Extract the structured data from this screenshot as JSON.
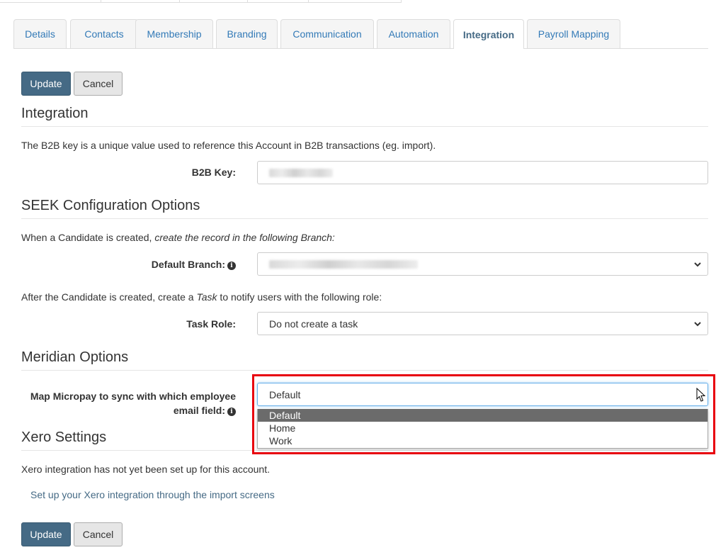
{
  "tabs": [
    {
      "label": "Details",
      "active": false
    },
    {
      "label": "Contacts",
      "active": false
    },
    {
      "label": "Membership",
      "active": false
    },
    {
      "label": "Branding",
      "active": false
    },
    {
      "label": "Communication",
      "active": false
    },
    {
      "label": "Automation",
      "active": false
    },
    {
      "label": "Integration",
      "active": true
    },
    {
      "label": "Payroll Mapping",
      "active": false
    }
  ],
  "actions": {
    "update_label": "Update",
    "cancel_label": "Cancel"
  },
  "integration": {
    "title": "Integration",
    "description": "The B2B key is a unique value used to reference this Account in B2B transactions (eg. import).",
    "b2b_key_label": "B2B Key:",
    "b2b_key_value": ""
  },
  "seek": {
    "title": "SEEK Configuration Options",
    "branch_intro_plain": "When a Candidate is created, ",
    "branch_intro_italic": "create the record in the following Branch:",
    "default_branch_label": "Default Branch:",
    "default_branch_value": "",
    "task_intro_plain": "After the Candidate is created, create a ",
    "task_intro_italic": "Task",
    "task_intro_tail": " to notify users with the following role:",
    "task_role_label": "Task Role:",
    "task_role_value": "Do not create a task"
  },
  "meridian": {
    "title": "Meridian Options",
    "email_field_label_line1": "Map Micropay to sync with which employee",
    "email_field_label_line2": "email field:",
    "email_field_value": "Default",
    "email_field_options": [
      "Default",
      "Home",
      "Work"
    ],
    "highlight_color": "#e8000e"
  },
  "xero": {
    "title": "Xero Settings",
    "status": "Xero integration has not yet been set up for this account.",
    "setup_link": "Set up your Xero integration through the import screens"
  },
  "icons": {
    "info": "info-circle-icon",
    "chevron": "chevron-down-icon",
    "cursor": "mouse-pointer-icon"
  },
  "colors": {
    "primary": "#456a85",
    "link": "#456a85",
    "tab_text": "#337ab7",
    "selected_option": "#6b6b6b"
  }
}
